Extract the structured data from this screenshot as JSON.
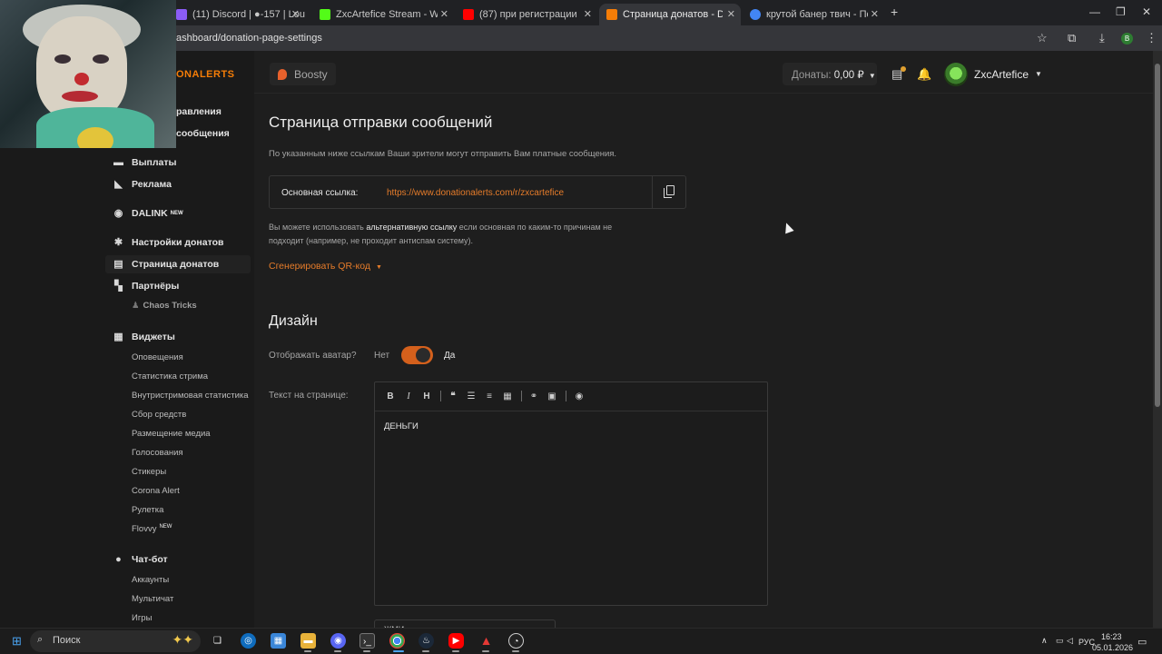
{
  "browser": {
    "tabs": [
      {
        "title": "(11) Discord | ●-157 | Lou",
        "favicon_color": "#8b5cf6",
        "active": false
      },
      {
        "title": "ZxcArtefice Stream - Watch Live",
        "favicon_color": "#53fc18",
        "active": false
      },
      {
        "title": "(87) при регистрации на кике",
        "favicon_color": "#ff0000",
        "active": false
      },
      {
        "title": "Страница донатов - DonationAl",
        "favicon_color": "#f57d07",
        "active": true
      },
      {
        "title": "крутой банер твич - Поиск в Г",
        "favicon_color": "#4285f4",
        "active": false
      }
    ],
    "close_glyph": "✕",
    "new_tab_glyph": "+",
    "url": "ashboard/donation-page-settings",
    "profile_initial": "B"
  },
  "brand": "ONALERTS",
  "sidebar": {
    "partial_items": [
      {
        "label": "равления"
      },
      {
        "label": "сообщения"
      }
    ],
    "items": [
      {
        "label": "Выплаты",
        "icon": "wallet-icon"
      },
      {
        "label": "Реклама",
        "icon": "megaphone-icon"
      },
      {
        "label": "DALINK",
        "icon": "dalink-icon",
        "badge": "NEW"
      },
      {
        "label": "Настройки донатов",
        "icon": "gear-icon"
      },
      {
        "label": "Страница донатов",
        "icon": "page-icon",
        "active": true
      },
      {
        "label": "Партнёры",
        "icon": "partners-icon"
      },
      {
        "label": "Виджеты",
        "icon": "widgets-icon"
      },
      {
        "label": "Чат-бот",
        "icon": "chat-icon"
      }
    ],
    "partners_sub": [
      "Chaos Tricks"
    ],
    "widgets_sub": [
      "Оповещения",
      "Статистика стрима",
      "Внутристримовая статистика",
      "Сбор средств",
      "Размещение медиа",
      "Голосования",
      "Стикеры",
      "Corona Alert",
      "Рулетка",
      "Flovvy"
    ],
    "flovvy_badge": "NEW",
    "chatbot_sub": [
      "Аккаунты",
      "Мультичат",
      "Игры"
    ]
  },
  "header": {
    "boosty_label": "Boosty",
    "donates_label": "Донаты:",
    "donates_value": "0,00 ₽",
    "username": "ZxcArtefice"
  },
  "main": {
    "title": "Страница отправки сообщений",
    "description": "По указанным ниже ссылкам Ваши зрители могут отправить Вам платные сообщения.",
    "link_label": "Основная ссылка:",
    "link_url": "https://www.donationalerts.com/r/zxcartefice",
    "alt_prefix": "Вы можете использовать",
    "alt_link": "альтернативную ссылку",
    "alt_suffix": "если основная по каким-то причинам не",
    "alt_line2": "подходит (например, не проходит антиспам систему).",
    "qr_label": "Сгенерировать QR-код",
    "design_title": "Дизайн",
    "avatar_question": "Отображать аватар?",
    "toggle_no": "Нет",
    "toggle_yes": "Да",
    "toggle_on": true,
    "text_label": "Текст на странице:",
    "editor_text": "ДЕНЬГИ",
    "next_field_text": "ЖМИ"
  },
  "taskbar": {
    "search_placeholder": "Поиск",
    "lang": "РУС",
    "time": "16:23",
    "date": "05.01.2026"
  },
  "colors": {
    "accent": "#e67c2a",
    "toggle": "#d4601c",
    "background": "#1e1e1e"
  }
}
